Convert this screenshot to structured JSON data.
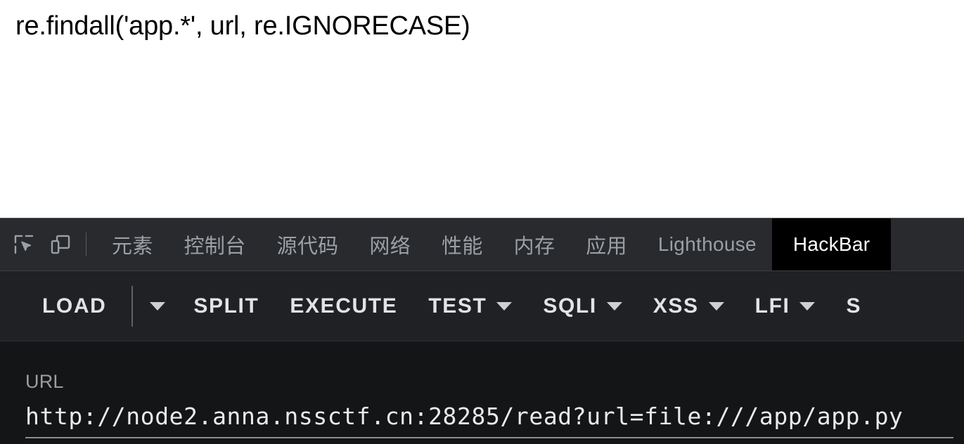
{
  "page": {
    "code_line": "re.findall('app.*', url, re.IGNORECASE)"
  },
  "devtools": {
    "icons": [
      {
        "name": "inspect-element-icon",
        "title": "检查元素"
      },
      {
        "name": "device-toolbar-icon",
        "title": "切换设备工具栏"
      }
    ],
    "tabs": [
      {
        "label": "元素",
        "active": false,
        "latin": false
      },
      {
        "label": "控制台",
        "active": false,
        "latin": false
      },
      {
        "label": "源代码",
        "active": false,
        "latin": false
      },
      {
        "label": "网络",
        "active": false,
        "latin": false
      },
      {
        "label": "性能",
        "active": false,
        "latin": false
      },
      {
        "label": "内存",
        "active": false,
        "latin": false
      },
      {
        "label": "应用",
        "active": false,
        "latin": false
      },
      {
        "label": "Lighthouse",
        "active": false,
        "latin": true
      },
      {
        "label": "HackBar",
        "active": true,
        "latin": true
      }
    ],
    "active_tab": "HackBar"
  },
  "hackbar": {
    "toolbar": [
      {
        "label": "LOAD",
        "caret": false
      },
      {
        "label": "",
        "caret_only": true
      },
      {
        "label": "SPLIT",
        "caret": false
      },
      {
        "label": "EXECUTE",
        "caret": false
      },
      {
        "label": "TEST",
        "caret": true
      },
      {
        "label": "SQLI",
        "caret": true
      },
      {
        "label": "XSS",
        "caret": true
      },
      {
        "label": "LFI",
        "caret": true
      },
      {
        "label": "S",
        "caret": false
      }
    ],
    "url": {
      "label": "URL",
      "value": "http://node2.anna.nssctf.cn:28285/read?url=file:///app/app.py",
      "placeholder": "URL"
    }
  },
  "colors": {
    "page_bg": "#ffffff",
    "devtools_bg": "#202124",
    "tabstrip_bg": "#282a2d",
    "active_tab_bg": "#000000",
    "panel_bg": "#141516",
    "tab_text": "#9aa0a6",
    "active_tab_text": "#ffffff",
    "button_text": "#e3e3e3",
    "label_text": "#9e9e9e",
    "url_text": "#e8eaed",
    "underline": "#8a8d90"
  }
}
